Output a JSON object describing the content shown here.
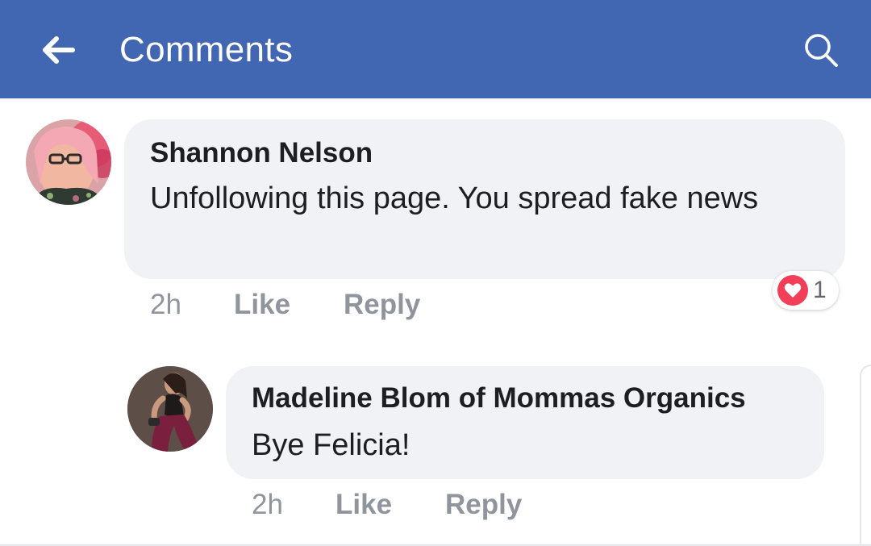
{
  "theme": {
    "brand": "#4267b2",
    "love": "#f33e58"
  },
  "header": {
    "title": "Comments",
    "back_icon": "arrow-left-icon",
    "search_icon": "search-icon"
  },
  "comments": [
    {
      "author": "Shannon Nelson",
      "text": "Unfollowing this page. You spread fake news",
      "time": "2h",
      "like_label": "Like",
      "reply_label": "Reply",
      "reactions": {
        "type": "love",
        "icon": "heart-icon",
        "count": "1"
      }
    },
    {
      "author": "Madeline Blom of Mommas Organics",
      "text": "Bye Felicia!",
      "time": "2h",
      "like_label": "Like",
      "reply_label": "Reply"
    }
  ]
}
